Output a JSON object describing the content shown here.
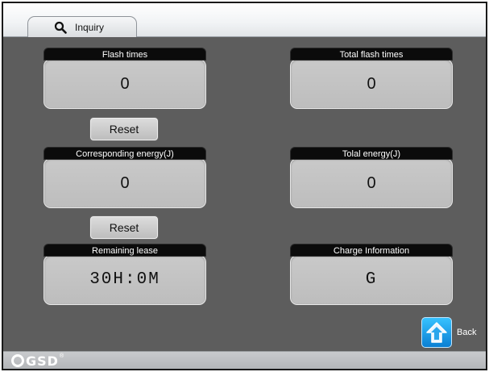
{
  "tab": {
    "label": "Inquiry",
    "icon": "search-icon"
  },
  "panels": {
    "flash_times": {
      "title": "Flash times",
      "value": "0"
    },
    "total_flash_times": {
      "title": "Total flash times",
      "value": "0"
    },
    "corresponding_energy": {
      "title": "Corresponding energy(J)",
      "value": "0"
    },
    "total_energy": {
      "title": "Tolal energy(J)",
      "value": "0"
    },
    "remaining_lease": {
      "title": "Remaining lease",
      "value": "30H:0M"
    },
    "charge_information": {
      "title": "Charge Information",
      "value": "G"
    }
  },
  "buttons": {
    "reset_flash": "Reset",
    "reset_energy": "Reset",
    "back": "Back"
  },
  "footer": {
    "logo_text": "GSD",
    "logo_mark": "®"
  },
  "colors": {
    "background": "#5d5d5d",
    "panel_header": "#0b0b0b",
    "panel_value": "#c4c4c4",
    "back_button": "#1a9be8"
  }
}
